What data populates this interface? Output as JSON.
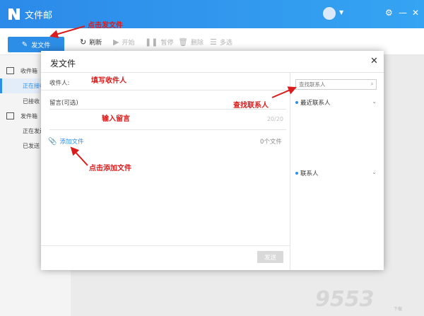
{
  "app": {
    "title": "文件邮"
  },
  "toolbar": {
    "send_label": "发文件",
    "refresh_label": "刷新",
    "start_label": "开始",
    "pause_label": "暂停",
    "delete_label": "删除",
    "multiselect_label": "多选"
  },
  "sidebar": {
    "inbox": {
      "label": "收件箱",
      "items": [
        "正在接收",
        "已接收"
      ]
    },
    "outbox": {
      "label": "发件箱",
      "items": [
        "正在发送",
        "已发送"
      ]
    }
  },
  "dialog": {
    "title": "发文件",
    "recipient_label": "收件人:",
    "message_label": "留言(可选)",
    "message_value": "",
    "message_counter": "20/20",
    "add_file_label": "添加文件",
    "file_count": "0个文件",
    "submit_label": "发送",
    "search_placeholder": "查找联系人",
    "recent_contacts_label": "最近联系人",
    "contacts_label": "联系人"
  },
  "annotations": {
    "click_send": "点击发文件",
    "fill_recipient": "填写收件人",
    "find_contact": "查找联系人",
    "input_message": "输入留言",
    "click_add_file": "点击添加文件"
  },
  "watermark": {
    "text": "9553",
    "sub": "下载"
  },
  "colors": {
    "accent": "#2d8ee8",
    "annotation": "#d91c1c",
    "titlebar": "#2c8ae9"
  }
}
